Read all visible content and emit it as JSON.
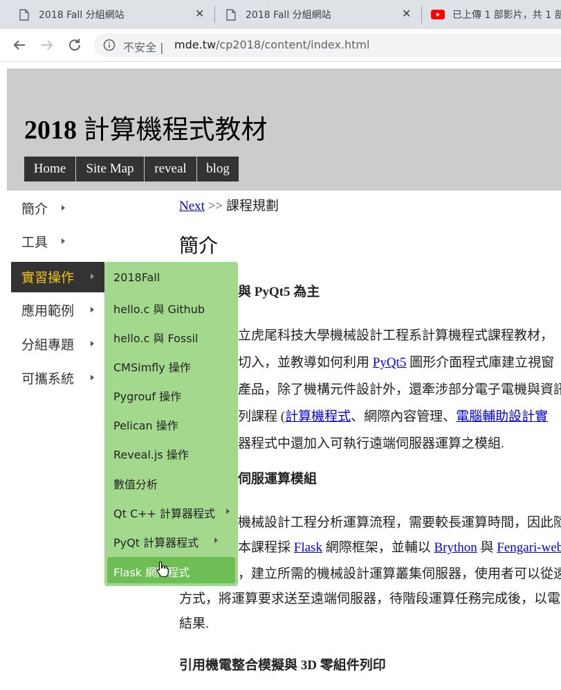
{
  "browser": {
    "tabs": [
      {
        "title": "2018 Fall 分組網站",
        "close": "✕"
      },
      {
        "title": "2018 Fall 分組網站",
        "close": "✕"
      },
      {
        "title": "已上傳 1 部影片，共 1 部"
      }
    ],
    "security_label": "不安全",
    "url_host": "mde.tw",
    "url_path": "/cp2018/content/index.html"
  },
  "site": {
    "title_year": "2018",
    "title_text": " 計算機程式教材",
    "nav": [
      "Home",
      "Site Map",
      "reveal",
      "blog"
    ]
  },
  "side_menu": {
    "items": [
      {
        "label": "簡介"
      },
      {
        "label": "工具"
      },
      {
        "label": "實習操作"
      },
      {
        "label": "應用範例"
      },
      {
        "label": "分組專題"
      },
      {
        "label": "可攜系統"
      }
    ]
  },
  "dropdown": {
    "items": [
      {
        "label": "2018Fall"
      },
      {
        "label": "hello.c 與 Github"
      },
      {
        "label": "hello.c 與 Fossil"
      },
      {
        "label": "CMSimfly 操作"
      },
      {
        "label": "Pygrouf 操作"
      },
      {
        "label": "Pelican 操作"
      },
      {
        "label": "Reveal.js 操作"
      },
      {
        "label": "數值分析"
      },
      {
        "label": "Qt C++ 計算器程式"
      },
      {
        "label": "PyQt 計算器程式"
      },
      {
        "label": "Flask 網際程式"
      }
    ]
  },
  "content": {
    "breadcrumb_link": "Next",
    "breadcrumb_sep": " >> ",
    "breadcrumb_text": "課程規劃",
    "title": "簡介",
    "heading1": "與 PyQt5 為主",
    "p1_line1": "立虎尾科技大學機械設計工程系計算機程式課程教材，",
    "p1_line2a": "切入，並教導如何利用 ",
    "p1_line2_link": "PyQt5",
    "p1_line2b": " 圖形介面程式庫建立視窗",
    "p1_line3": "產品，除了機構元件設計外，還牽涉部分電子電機與資訊",
    "p1_line4a": "列課程 (",
    "p1_line4_link1": "計算機程式",
    "p1_line4b": "、網際內容管理、",
    "p1_line4_link2": "電腦輔助設計實",
    "p1_line5": "器程式中還加入可執行遠端伺服器運算之模組.",
    "heading2": "伺服運算模組",
    "p2_line1": "機械設計工程分析運算流程，需要較長運算時間，因此隨",
    "p2_line2a": "本課程採 ",
    "p2_line2_link1": "Flask",
    "p2_line2b": " 網際框架，並輔以 ",
    "p2_line2_link2": "Brython",
    "p2_line2c": " 與 ",
    "p2_line2_link3": "Fengari-web",
    "p2_line3": "，建立所需的機械設計運算叢集伺服器，使用者可以從遠",
    "p2_line4": "方式，將運算要求送至遠端伺服器，待階段運算任務完成後，以電",
    "p2_line5": "結果.",
    "heading3": "引用機電整合模擬與 3D 零組件列印"
  }
}
